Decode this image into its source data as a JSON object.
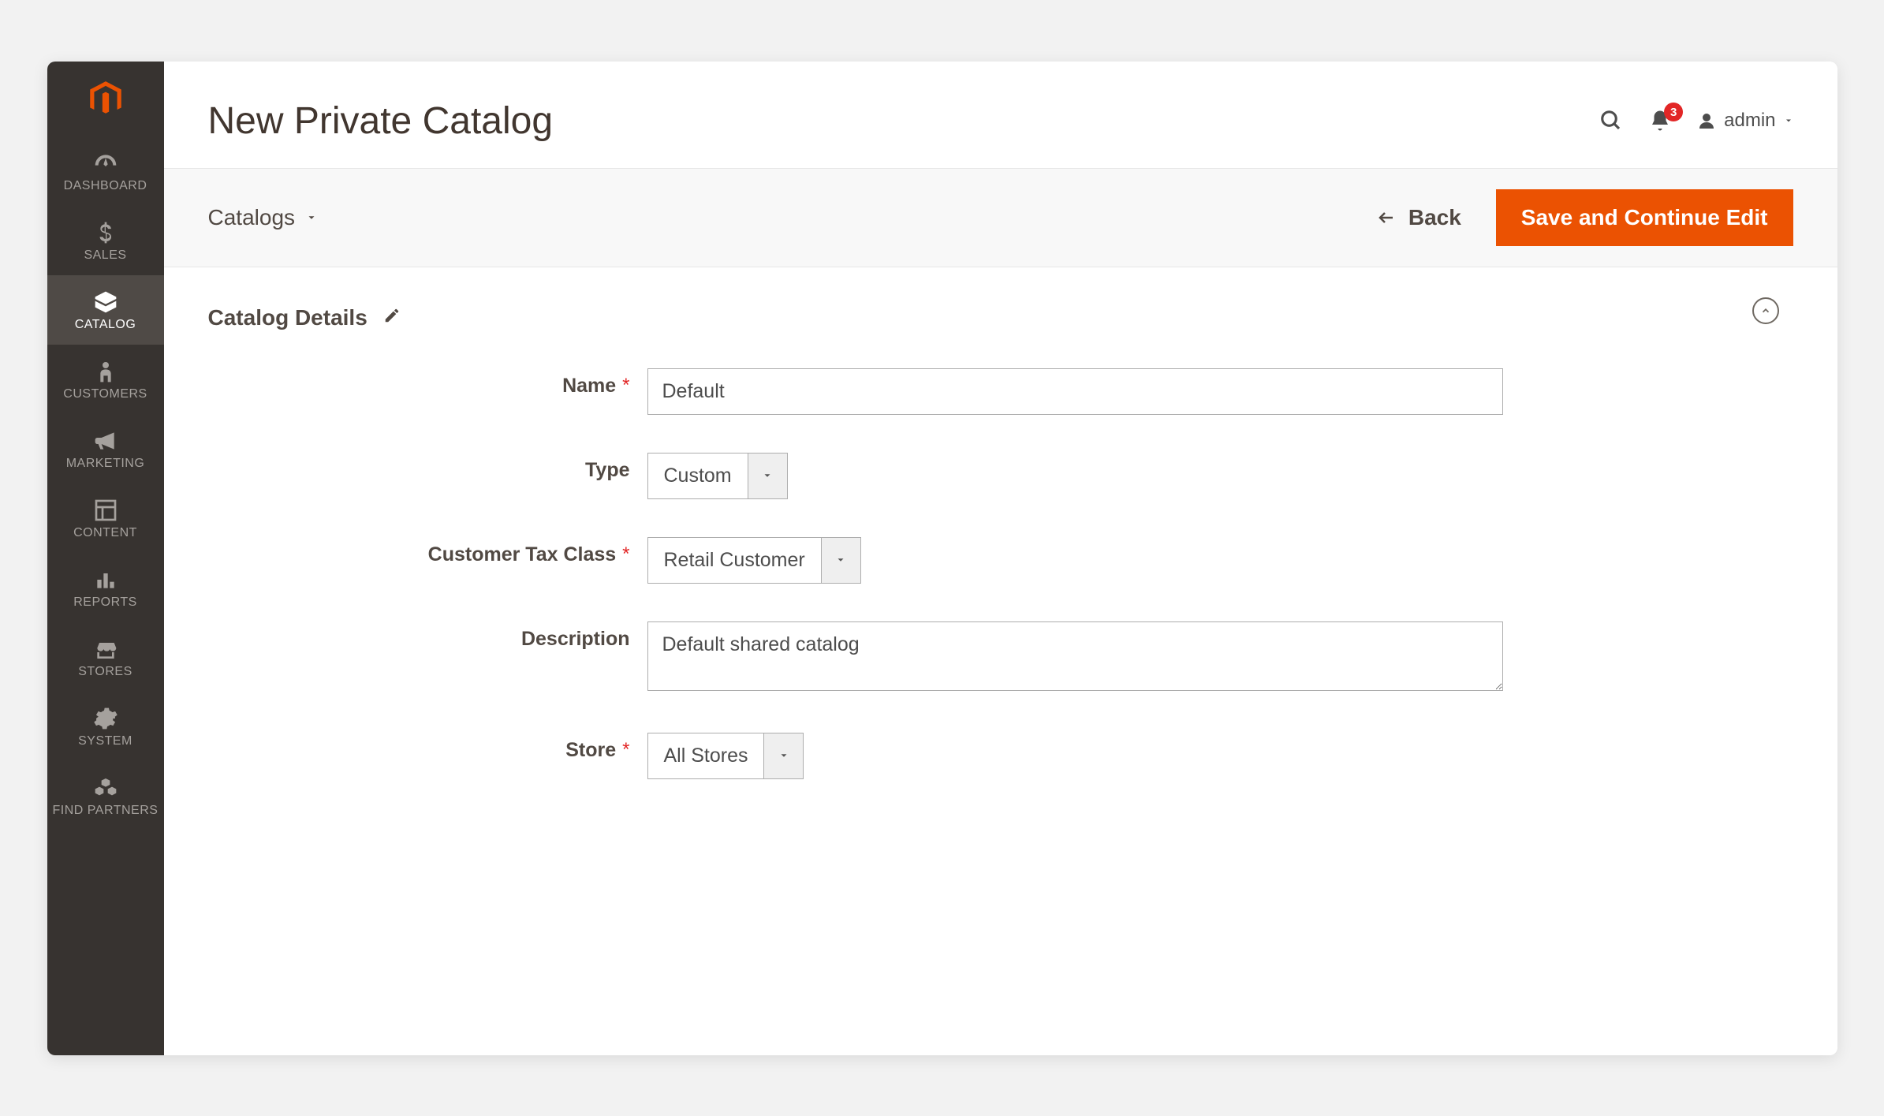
{
  "sidebar": {
    "items": [
      {
        "label": "DASHBOARD",
        "icon": "speedometer"
      },
      {
        "label": "SALES",
        "icon": "dollar"
      },
      {
        "label": "CATALOG",
        "icon": "box"
      },
      {
        "label": "CUSTOMERS",
        "icon": "person"
      },
      {
        "label": "MARKETING",
        "icon": "megaphone"
      },
      {
        "label": "CONTENT",
        "icon": "layout"
      },
      {
        "label": "REPORTS",
        "icon": "bars"
      },
      {
        "label": "STORES",
        "icon": "storefront"
      },
      {
        "label": "SYSTEM",
        "icon": "gear"
      },
      {
        "label": "FIND PARTNERS",
        "icon": "blocks"
      }
    ]
  },
  "header": {
    "title": "New Private Catalog",
    "notification_count": "3",
    "user": "admin"
  },
  "actionbar": {
    "breadcrumb": "Catalogs",
    "back_label": "Back",
    "save_label": "Save and Continue Edit"
  },
  "section": {
    "title": "Catalog Details"
  },
  "form": {
    "name": {
      "label": "Name",
      "value": "Default"
    },
    "type": {
      "label": "Type",
      "value": "Custom"
    },
    "tax_class": {
      "label": "Customer Tax Class",
      "value": "Retail Customer"
    },
    "description": {
      "label": "Description",
      "value": "Default shared catalog"
    },
    "store": {
      "label": "Store",
      "value": "All Stores"
    }
  },
  "colors": {
    "accent": "#eb5202",
    "sidebar_bg": "#373330",
    "danger": "#e22626"
  }
}
